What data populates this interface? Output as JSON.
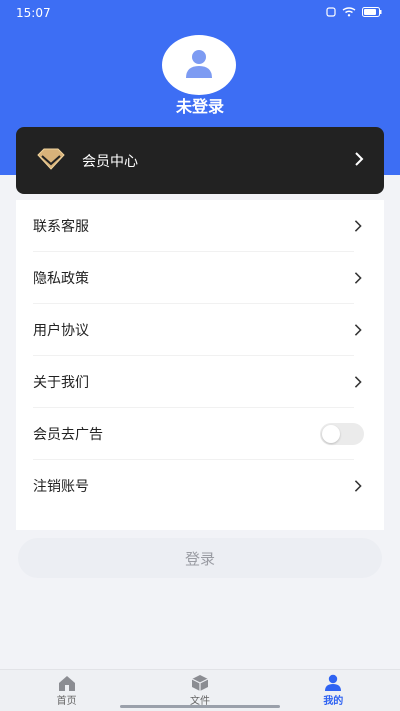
{
  "status_bar": {
    "time": "15:07",
    "battery": "[▭]"
  },
  "profile": {
    "name": "未登录"
  },
  "vip": {
    "label": "会员中心"
  },
  "menu": [
    {
      "label": "联系客服",
      "type": "arrow"
    },
    {
      "label": "隐私政策",
      "type": "arrow"
    },
    {
      "label": "用户协议",
      "type": "arrow"
    },
    {
      "label": "关于我们",
      "type": "arrow"
    },
    {
      "label": "会员去广告",
      "type": "toggle",
      "on": false
    },
    {
      "label": "注销账号",
      "type": "arrow"
    }
  ],
  "login_button": "登录",
  "tabs": [
    {
      "label": "首页",
      "icon": "home-icon",
      "active": false
    },
    {
      "label": "文件",
      "icon": "cube-icon",
      "active": false
    },
    {
      "label": "我的",
      "icon": "user-icon",
      "active": true
    }
  ],
  "colors": {
    "accent": "#3d6ef4",
    "vip_bg": "#222222",
    "tab_active": "#2f63f2"
  }
}
